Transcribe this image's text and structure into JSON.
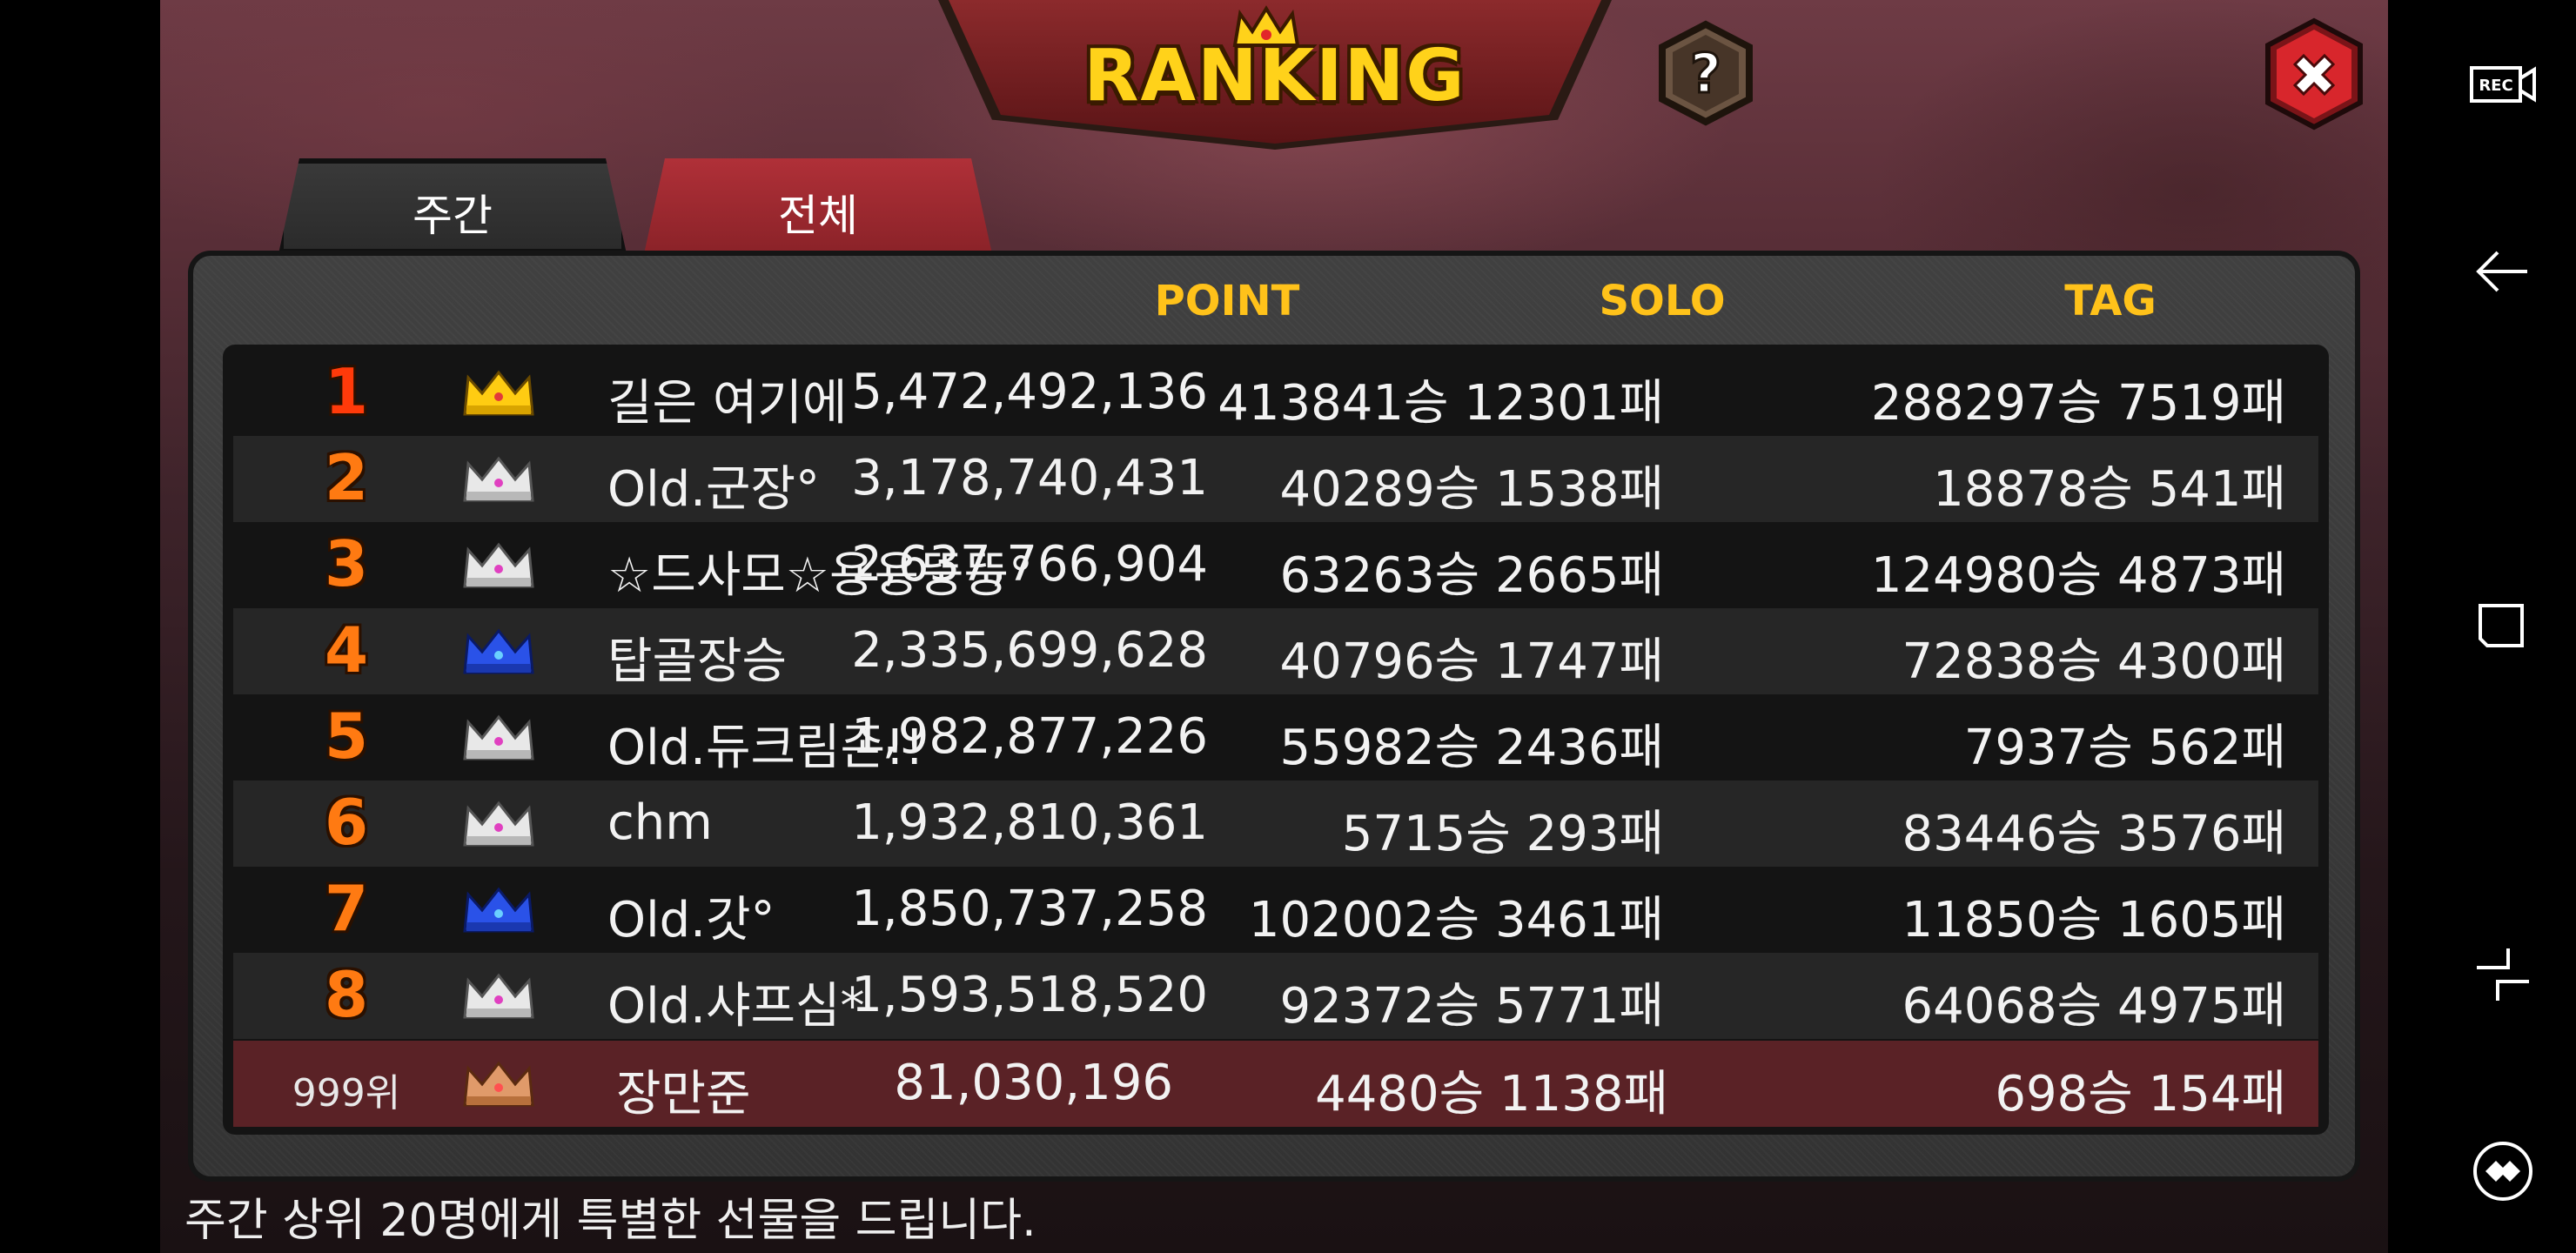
{
  "header": {
    "title": "RANKING",
    "help_label": "?",
    "close_label": "✖"
  },
  "tabs": [
    {
      "label": "주간",
      "selected": true
    },
    {
      "label": "전체",
      "selected": false
    }
  ],
  "columns": {
    "point": "POINT",
    "solo": "SOLO",
    "tag": "TAG"
  },
  "rows": [
    {
      "rank": "1",
      "crown": "gold-crown",
      "name": "길은 여기에",
      "point": "5,472,492,136",
      "solo": "413841승 12301패",
      "tag": "288297승 7519패"
    },
    {
      "rank": "2",
      "crown": "silver-crown",
      "name": "Old.군장°",
      "point": "3,178,740,431",
      "solo": "40289승 1538패",
      "tag": "18878승 541패"
    },
    {
      "rank": "3",
      "crown": "silver-crown",
      "name": "☆드사모☆용용뚱뚱°",
      "point": "2,637,766,904",
      "solo": "63263승 2665패",
      "tag": "124980승 4873패"
    },
    {
      "rank": "4",
      "crown": "blue-crown",
      "name": "탑골장승",
      "point": "2,335,699,628",
      "solo": "40796승 1747패",
      "tag": "72838승 4300패"
    },
    {
      "rank": "5",
      "crown": "silver-crown",
      "name": "Old.듀크림존!!",
      "point": "1,982,877,226",
      "solo": "55982승 2436패",
      "tag": "7937승 562패"
    },
    {
      "rank": "6",
      "crown": "silver-crown",
      "name": "chm",
      "point": "1,932,810,361",
      "solo": "5715승 293패",
      "tag": "83446승 3576패"
    },
    {
      "rank": "7",
      "crown": "blue-crown",
      "name": "Old.갓°",
      "point": "1,850,737,258",
      "solo": "102002승 3461패",
      "tag": "11850승 1605패"
    },
    {
      "rank": "8",
      "crown": "silver-crown",
      "name": "Old.샤프심*",
      "point": "1,593,518,520",
      "solo": "92372승 5771패",
      "tag": "64068승 4975패"
    }
  ],
  "my_row": {
    "rank": "999위",
    "crown": "bronze-crown",
    "name": "장만준",
    "point": "81,030,196",
    "solo": "4480승 1138패",
    "tag": "698승 154패"
  },
  "footer_note": "주간 상위 20명에게 특별한 선물을 드립니다.",
  "system_nav": [
    "rec-icon",
    "back-icon",
    "recents-icon",
    "home-icon",
    "game-tools-icon"
  ],
  "colors": {
    "gold": "#ffd21a",
    "header_text": "#ffc21a",
    "rank_orange": "#ff7a12",
    "tab_red": "#b03038",
    "my_row_bg": "#5a2226"
  }
}
